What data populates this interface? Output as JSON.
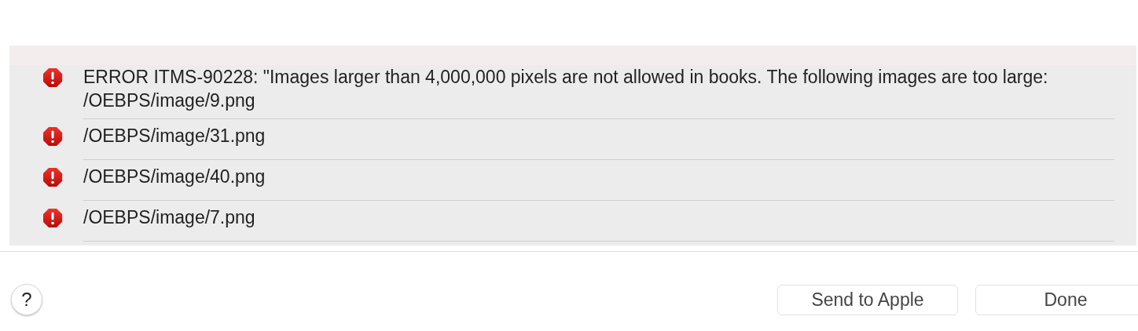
{
  "issues": [
    {
      "kind": "error",
      "message": "ERROR ITMS-90228: \"Images larger than 4,000,000 pixels are not allowed in books.  The following images are too large: /OEBPS/image/9.png"
    },
    {
      "kind": "error",
      "message": "/OEBPS/image/31.png"
    },
    {
      "kind": "error",
      "message": "/OEBPS/image/40.png"
    },
    {
      "kind": "error",
      "message": "/OEBPS/image/7.png"
    }
  ],
  "help_button": {
    "label": "?"
  },
  "buttons": [
    {
      "label": "Send to Apple"
    },
    {
      "label": "Done"
    }
  ]
}
